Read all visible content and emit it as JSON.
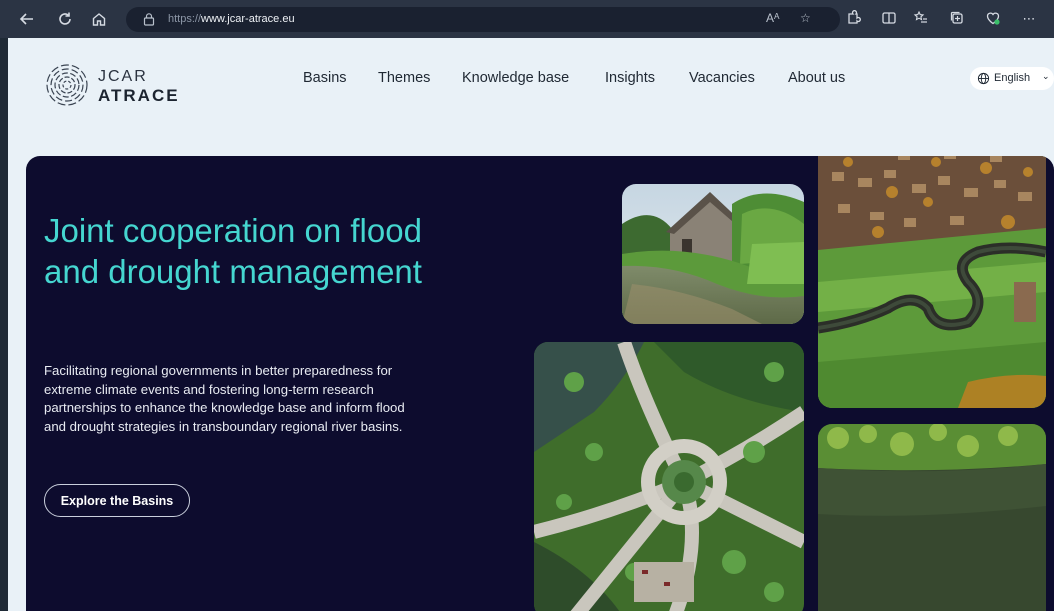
{
  "browser": {
    "url_prefix": "https://",
    "url_domain": "www.jcar-atrace.eu",
    "read_aloud": "Aᴬ",
    "favorite_icon": "star-icon",
    "toolbar_icons": [
      "extensions-icon",
      "split-screen-icon",
      "favorites-icon",
      "collections-icon",
      "browser-essentials-icon",
      "more-icon"
    ]
  },
  "logo": {
    "line1": "JCAR",
    "line2": "ATRACE"
  },
  "nav": {
    "items": [
      {
        "label": "Basins"
      },
      {
        "label": "Themes"
      },
      {
        "label": "Knowledge base"
      },
      {
        "label": "Insights"
      },
      {
        "label": "Vacancies"
      },
      {
        "label": "About us"
      }
    ]
  },
  "language": {
    "label": "English"
  },
  "hero": {
    "title": "Joint cooperation on flood and drought management",
    "description": "Facilitating regional governments in better preparedness for extreme climate events and fostering long-term research partnerships to enhance the knowledge base and inform flood and drought strategies in transboundary regional river basins.",
    "cta": "Explore the Basins"
  },
  "images": [
    {
      "name": "mill-stream-photo"
    },
    {
      "name": "village-river-aerial-photo"
    },
    {
      "name": "roundabout-aerial-photo"
    },
    {
      "name": "lake-aerial-photo"
    }
  ],
  "colors": {
    "hero_bg": "#0d0c2e",
    "accent": "#45d6d0",
    "page_bg": "#e9f1f7"
  }
}
